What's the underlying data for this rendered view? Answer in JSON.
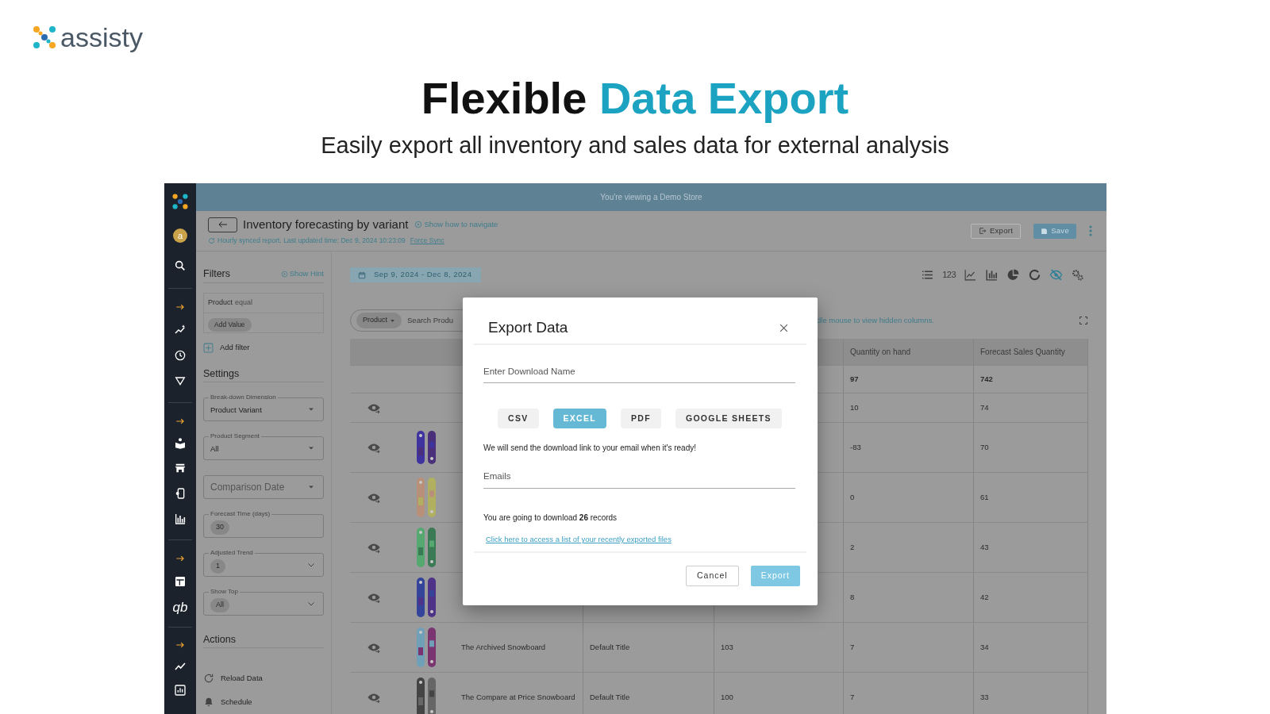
{
  "brand": {
    "name": "assisty"
  },
  "hero": {
    "title": "Flexible",
    "highlight": "Data Export",
    "subtitle": "Easily export all inventory and sales data for external analysis"
  },
  "app": {
    "demo_banner": "You're viewing a Demo Store",
    "sidebar": {
      "avatar": "a",
      "text_icon": "qb"
    },
    "header": {
      "title": "Inventory forecasting by variant",
      "help_link": "Show how to navigate",
      "sync_status": "Hourly synced report. Last updated time: Dec 9, 2024 10:23:09",
      "sync_link": "Force Sync",
      "buttons": [
        {
          "label": "Export",
          "kind": "outline"
        },
        {
          "label": "Save",
          "kind": "primary"
        }
      ]
    },
    "filters": {
      "title": "Filters",
      "hint_link": "Show Hint",
      "conditions": [
        {
          "field": "Product",
          "operator": "equal",
          "action": "Add Value"
        }
      ],
      "add_filter": "Add filter"
    },
    "settings": {
      "title": "Settings",
      "fields": [
        {
          "kind": "select",
          "label": "Break-down Dimension",
          "value": "Product Variant"
        },
        {
          "kind": "select",
          "label": "Product Segment",
          "value": "All"
        },
        {
          "kind": "placeholder_select",
          "placeholder": "Comparison Date"
        },
        {
          "kind": "chip",
          "label": "Forecast Time (days)",
          "value": "30"
        },
        {
          "kind": "chip_select",
          "label": "Adjusted Trend",
          "value": "1"
        },
        {
          "kind": "chip_select",
          "label": "Show Top",
          "value": "All"
        }
      ]
    },
    "actions": {
      "title": "Actions",
      "items": [
        {
          "kind": "reload",
          "label": "Reload Data"
        },
        {
          "kind": "schedule",
          "label": "Schedule"
        }
      ]
    },
    "toolbar": {
      "date_range": "Sep 9, 2024 - Dec 8, 2024",
      "views": [
        {
          "kind": "list",
          "selected": false
        },
        {
          "kind": "number",
          "label": "123",
          "selected": false
        },
        {
          "kind": "line",
          "selected": false
        },
        {
          "kind": "bar",
          "selected": false
        },
        {
          "kind": "pie",
          "selected": false
        },
        {
          "kind": "donut",
          "selected": false
        },
        {
          "kind": "hidden",
          "selected": true
        },
        {
          "kind": "settings",
          "selected": false
        }
      ]
    },
    "search": {
      "filter_chip": "Product",
      "placeholder": "Search Produ"
    },
    "columns_hint": "dle mouse to view hidden columns.",
    "table": {
      "columns": [
        "Quantity on hand",
        "Forecast Sales Quantity"
      ],
      "total": {
        "quantity_on_hand": "97",
        "forecast_sales_quantity": "742"
      },
      "rows": [
        {
          "image": false,
          "quantity_on_hand": "10",
          "forecast_sales_quantity": "74"
        },
        {
          "image": true,
          "quantity_on_hand": "-83",
          "forecast_sales_quantity": "70"
        },
        {
          "image": true,
          "quantity_on_hand": "0",
          "forecast_sales_quantity": "61"
        },
        {
          "image": true,
          "quantity_on_hand": "2",
          "forecast_sales_quantity": "43"
        },
        {
          "image": true,
          "quantity_on_hand": "8",
          "forecast_sales_quantity": "42"
        },
        {
          "image": true,
          "product": "The Archived Snowboard",
          "variant": "Default Title",
          "column_5": "103",
          "quantity_on_hand": "7",
          "forecast_sales_quantity": "34"
        },
        {
          "image": true,
          "product": "The Compare at Price Snowboard",
          "variant": "Default Title",
          "column_5": "100",
          "quantity_on_hand": "7",
          "forecast_sales_quantity": "33"
        }
      ]
    }
  },
  "dialog": {
    "title": "Export Data",
    "name_placeholder": "Enter Download Name",
    "formats": [
      {
        "label": "CSV",
        "selected": false
      },
      {
        "label": "EXCEL",
        "selected": true
      },
      {
        "label": "PDF",
        "selected": false
      },
      {
        "label": "GOOGLE SHEETS",
        "selected": false
      }
    ],
    "notice": "We will send the download link to your email when it's ready!",
    "email_placeholder": "Emails",
    "summary": "You are going to download **26** records",
    "history_link": "Click here to access a list of your recently exported files",
    "buttons": [
      {
        "label": "Cancel",
        "kind": "secondary"
      },
      {
        "label": "Export",
        "kind": "primary"
      }
    ]
  }
}
